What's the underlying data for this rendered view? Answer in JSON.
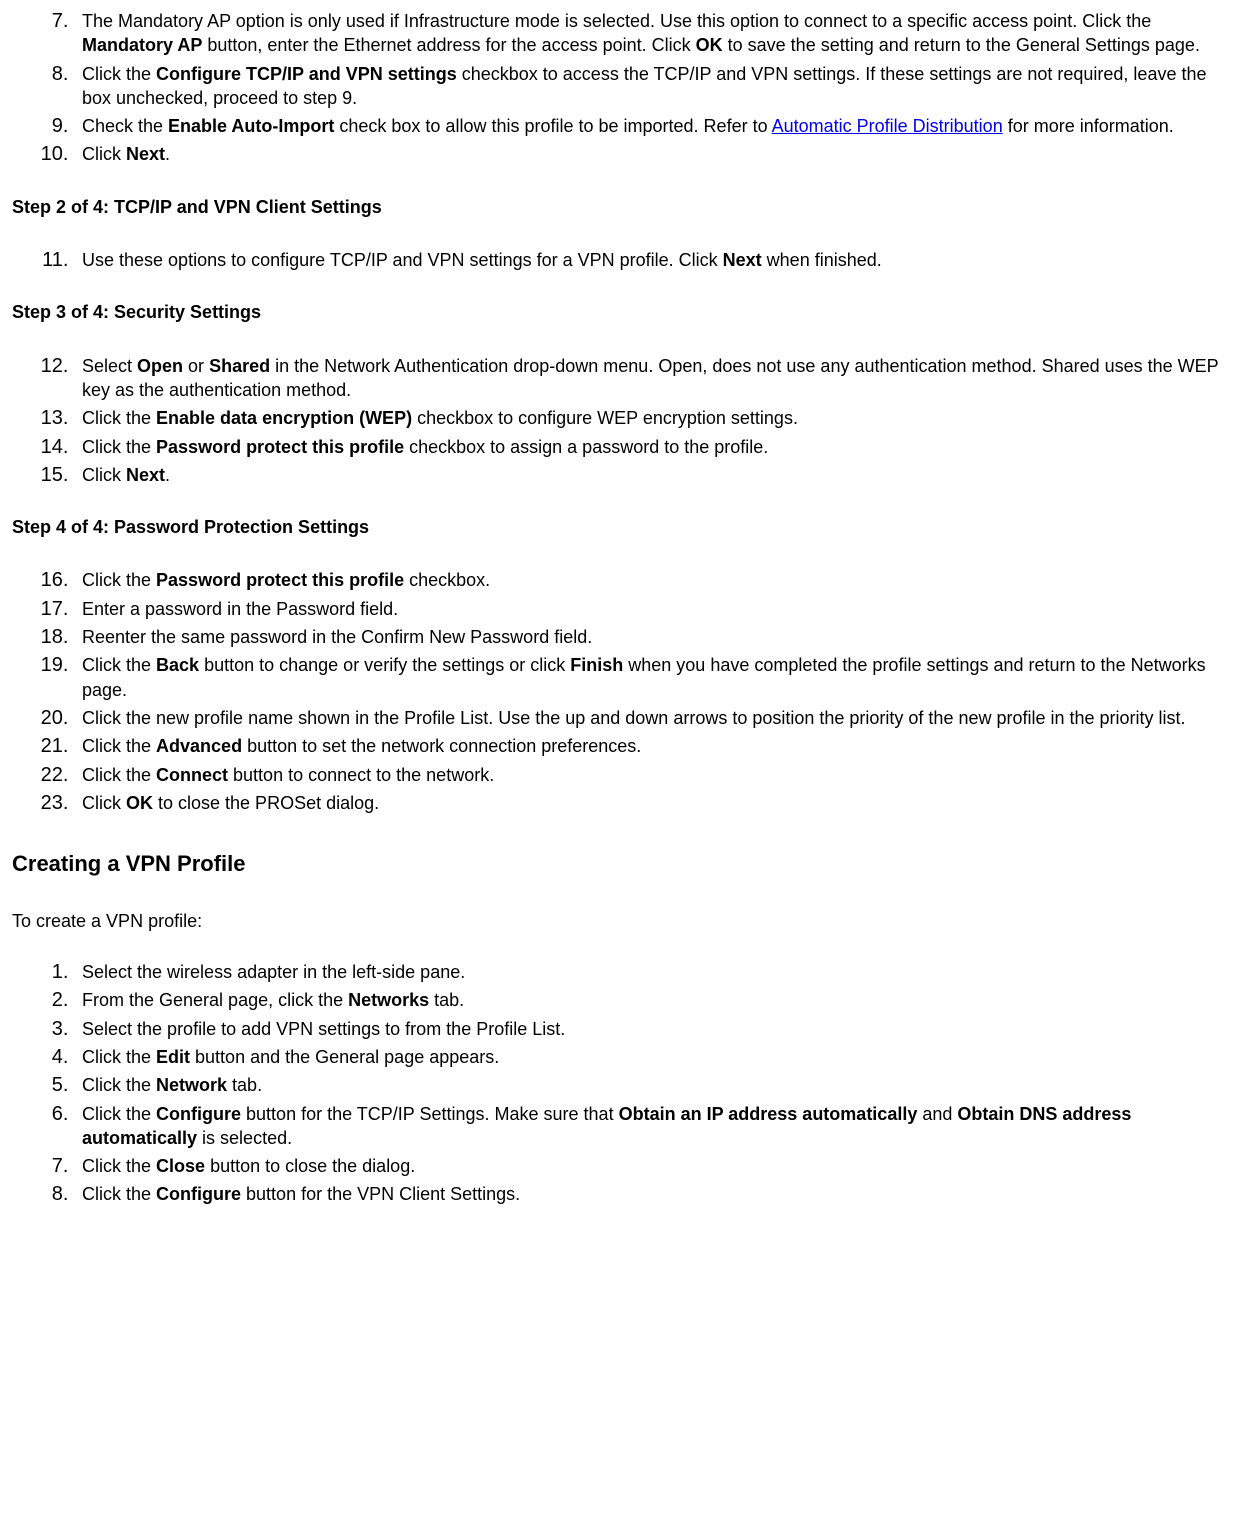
{
  "list1": {
    "start": 7,
    "items": [
      {
        "pre": "The Mandatory AP option is only used if Infrastructure mode is selected. Use this option to connect to a specific access point. Click the ",
        "b1": "Mandatory AP",
        "mid1": " button, enter the Ethernet address for the access point. Click ",
        "b2": "OK",
        "post": " to save the setting and return to the General Settings page."
      },
      {
        "pre": "Click the ",
        "b1": "Configure TCP/IP and VPN settings",
        "post": " checkbox to access the TCP/IP and VPN settings. If these settings are not required, leave the box unchecked, proceed to step 9."
      },
      {
        "pre": "Check the ",
        "b1": "Enable Auto-Import",
        "mid1": " check box to allow this profile to be imported. Refer to ",
        "link": "Automatic Profile Distribution",
        "post": " for more information."
      },
      {
        "pre": "Click ",
        "b1": "Next",
        "post": "."
      }
    ]
  },
  "step2_heading": "Step 2 of 4: TCP/IP and VPN Client Settings",
  "list2": {
    "start": 11,
    "items": [
      {
        "pre": "Use these options to configure TCP/IP and VPN settings for a VPN profile. Click ",
        "b1": "Next",
        "post": " when finished."
      }
    ]
  },
  "step3_heading": "Step 3 of 4: Security Settings",
  "list3": {
    "start": 12,
    "items": [
      {
        "pre": "Select ",
        "b1": "Open",
        "mid1": " or ",
        "b2": "Shared",
        "post": " in the Network Authentication drop-down menu. Open, does not use any authentication method. Shared uses the WEP key as the authentication method."
      },
      {
        "pre": "Click the ",
        "b1": "Enable data encryption (WEP)",
        "post": " checkbox to configure WEP encryption settings."
      },
      {
        "pre": "Click the ",
        "b1": "Password protect this profile",
        "post": " checkbox to assign a password to the profile."
      },
      {
        "pre": "Click ",
        "b1": "Next",
        "post": "."
      }
    ]
  },
  "step4_heading": "Step 4 of 4: Password Protection Settings",
  "list4": {
    "start": 16,
    "items": [
      {
        "pre": "Click the ",
        "b1": "Password protect this profile",
        "post": " checkbox."
      },
      {
        "pre": "Enter a password in the Password field."
      },
      {
        "pre": "Reenter the same password in the Confirm New Password field."
      },
      {
        "pre": "Click the ",
        "b1": "Back",
        "mid1": " button to change or verify the settings or click ",
        "b2": "Finish",
        "post": " when you have completed the profile settings and return to the Networks page."
      },
      {
        "pre": "Click the new profile name shown in the Profile List. Use the up and down arrows to position the priority of the new profile in the priority list."
      },
      {
        "pre": "Click the ",
        "b1": "Advanced",
        "post": " button to set the network connection preferences."
      },
      {
        "pre": "Click the ",
        "b1": "Connect",
        "post": " button to connect to the network."
      },
      {
        "pre": "Click ",
        "b1": "OK",
        "post": " to close the PROSet dialog."
      }
    ]
  },
  "section_heading": "Creating a VPN Profile",
  "intro_text": "To create a VPN profile:",
  "list5": {
    "start": 1,
    "items": [
      {
        "pre": "Select the wireless adapter in the left-side pane."
      },
      {
        "pre": "From the General page, click the ",
        "b1": "Networks",
        "post": " tab."
      },
      {
        "pre": "Select the profile to add VPN settings to from the Profile List."
      },
      {
        "pre": "Click the ",
        "b1": "Edit",
        "post": " button and the General page appears."
      },
      {
        "pre": "Click the ",
        "b1": "Network",
        "post": " tab."
      },
      {
        "pre": "Click the ",
        "b1": "Configure",
        "mid1": " button for the TCP/IP Settings. Make sure that ",
        "b2": "Obtain an IP address automatically",
        "mid2": " and ",
        "b3": "Obtain DNS address automatically",
        "post": " is selected."
      },
      {
        "pre": "Click the ",
        "b1": "Close",
        "post": " button to close the dialog."
      },
      {
        "pre": "Click the ",
        "b1": "Configure",
        "post": " button for the VPN Client Settings."
      }
    ]
  }
}
